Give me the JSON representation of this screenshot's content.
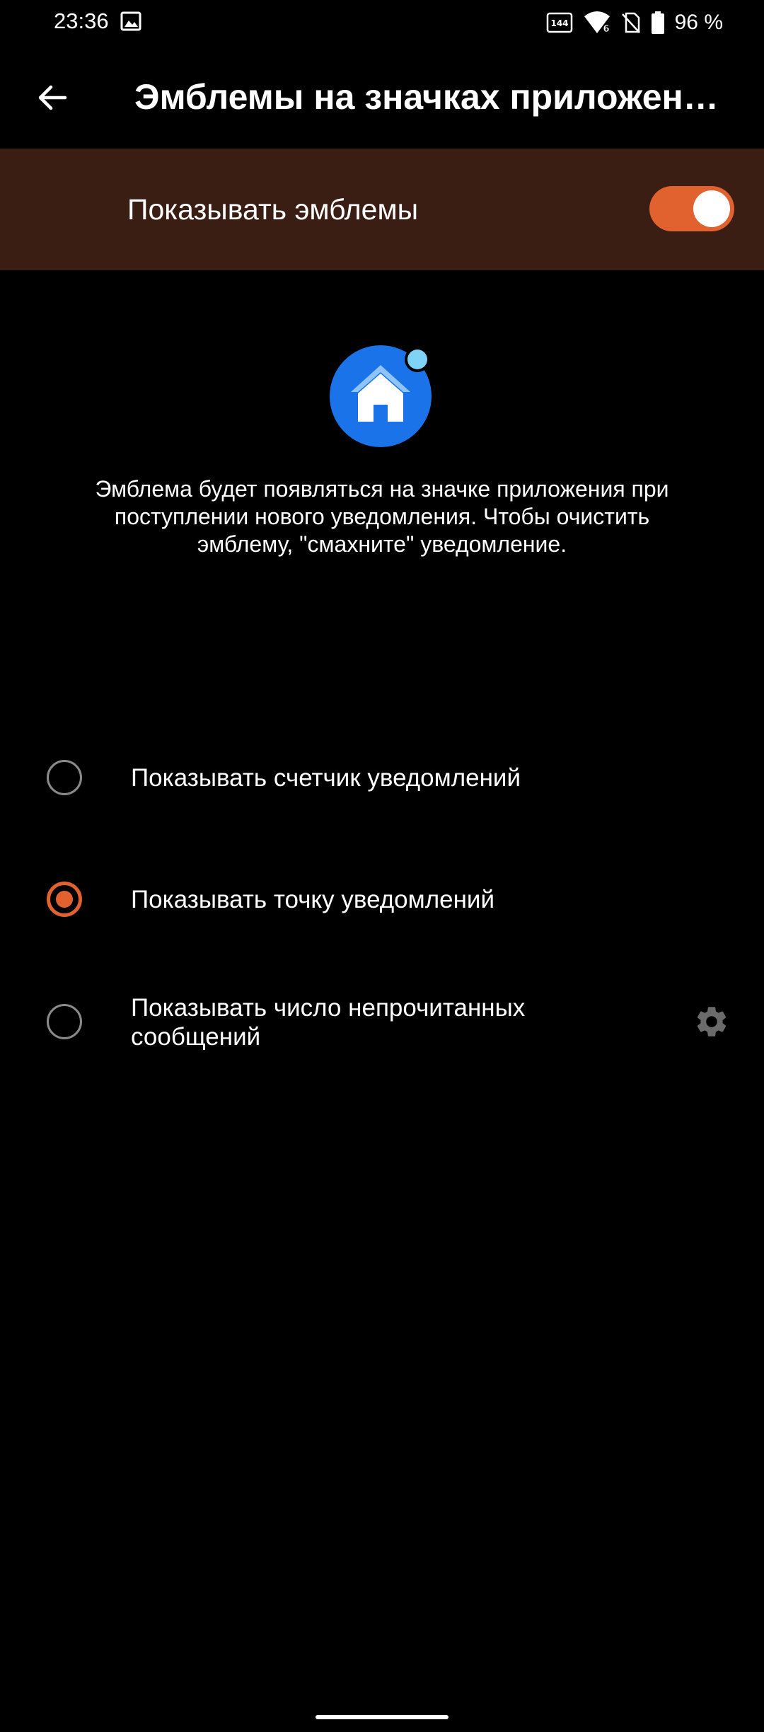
{
  "status_bar": {
    "time": "23:36",
    "refresh_rate_label": "144",
    "network_label": "6",
    "battery_text": "96 %",
    "icons": [
      "gallery-icon",
      "refresh-rate-icon",
      "wifi-icon",
      "no-sim-icon",
      "battery-icon"
    ]
  },
  "app_bar": {
    "title": "Эмблемы на значках приложен…",
    "back_icon": "arrow-left-icon"
  },
  "master": {
    "label": "Показывать эмблемы",
    "enabled": true
  },
  "illustration": {
    "icon": "home-icon",
    "badge_color": "#7fd3f7",
    "circle_color": "#1a73e8"
  },
  "description": "Эмблема будет появляться на значке приложения при поступлении нового уведомления. Чтобы очистить эмблему, \"смахните\" уведомление.",
  "options": [
    {
      "label": "Показывать счетчик уведомлений",
      "selected": false
    },
    {
      "label": "Показывать точку уведомлений",
      "selected": true
    },
    {
      "label": "Показывать число непрочитанных сообщений",
      "selected": false,
      "settings_icon": "gear-icon"
    }
  ],
  "colors": {
    "accent": "#e1622e",
    "master_row_bg": "#3a1e14",
    "background": "#000000"
  }
}
